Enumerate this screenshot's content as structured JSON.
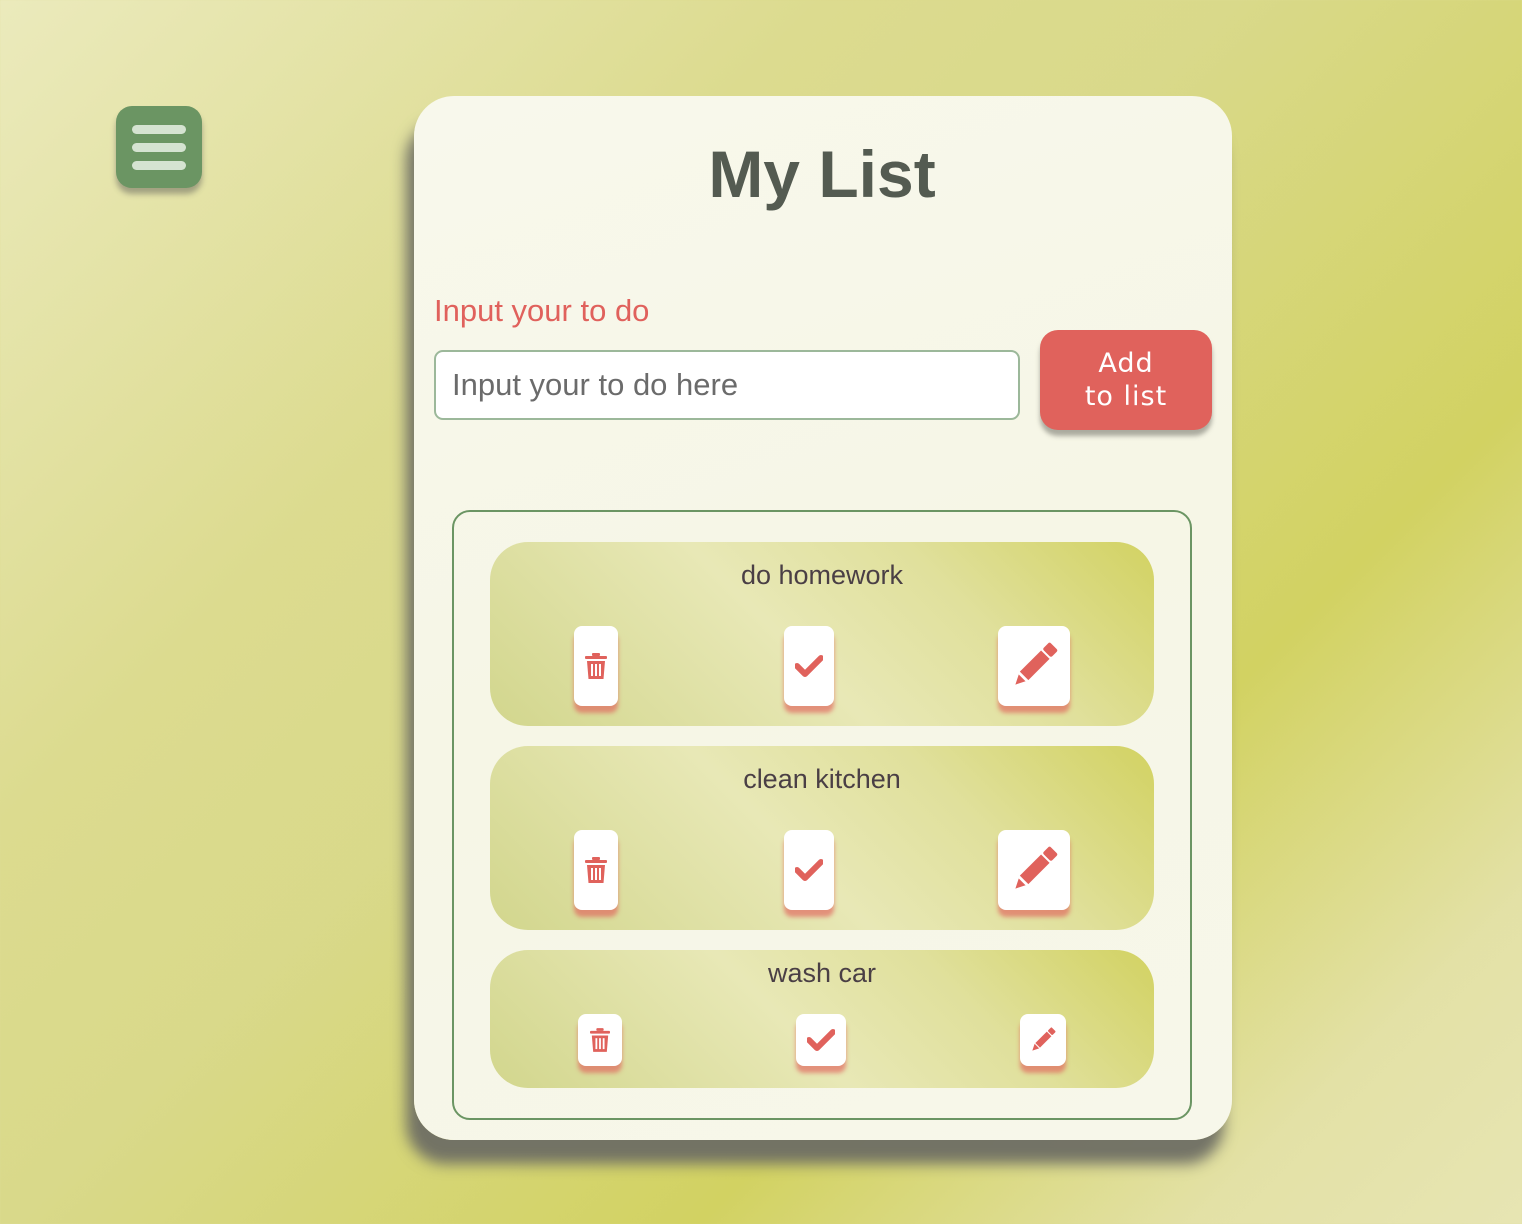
{
  "menu": {
    "icon": "hamburger-menu-icon"
  },
  "header": {
    "title": "My List"
  },
  "form": {
    "label": "Input your to do",
    "placeholder": "Input your to do here",
    "value": "",
    "add_button_line1": "Add",
    "add_button_line2": "to list"
  },
  "todos": [
    {
      "text": "do homework"
    },
    {
      "text": "clean kitchen"
    },
    {
      "text": "wash car"
    }
  ],
  "item_actions": [
    "trash-icon",
    "check-icon",
    "pencil-icon"
  ],
  "colors": {
    "accent": "#e0625c",
    "menu_green": "#6b9563",
    "title": "#545b51"
  }
}
